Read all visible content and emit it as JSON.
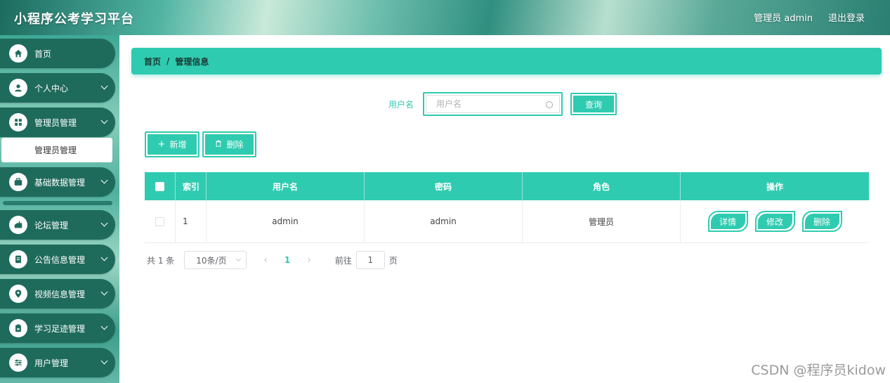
{
  "header": {
    "title": "小程序公考学习平台",
    "user": "管理员 admin",
    "logout": "退出登录"
  },
  "sidebar": {
    "items": [
      {
        "label": "首页",
        "icon": "home-icon"
      },
      {
        "label": "个人中心",
        "icon": "user-icon"
      },
      {
        "label": "管理员管理",
        "icon": "grid-icon"
      },
      {
        "label": "基础数据管理",
        "icon": "briefcase-icon"
      },
      {
        "label": "论坛管理",
        "icon": "mailbox-icon"
      },
      {
        "label": "公告信息管理",
        "icon": "document-icon"
      },
      {
        "label": "视频信息管理",
        "icon": "location-icon"
      },
      {
        "label": "学习足迹管理",
        "icon": "clipboard-icon"
      },
      {
        "label": "用户管理",
        "icon": "sliders-icon"
      }
    ],
    "submenu": {
      "label": "管理员管理"
    }
  },
  "breadcrumb": {
    "home": "首页",
    "separator": "/",
    "current": "管理信息"
  },
  "search": {
    "label": "用户名",
    "placeholder": "用户名",
    "query_label": "查询"
  },
  "toolbar": {
    "add_label": "新增",
    "delete_label": "删除"
  },
  "table": {
    "columns": [
      "索引",
      "用户名",
      "密码",
      "角色",
      "操作"
    ],
    "rows": [
      {
        "index": "1",
        "username": "admin",
        "password": "admin",
        "role": "管理员"
      }
    ],
    "actions": {
      "detail": "详情",
      "edit": "修改",
      "delete": "删除"
    }
  },
  "pagination": {
    "total": "共 1 条",
    "page_size": "10条/页",
    "prev": "‹",
    "current_page": "1",
    "next": "›",
    "goto_label": "前往",
    "goto_value": "1",
    "goto_suffix": "页"
  },
  "watermark": "CSDN @程序员kidow",
  "colors": {
    "accent": "#2fcbb0",
    "sidebar_item": "#1e6b5c"
  }
}
